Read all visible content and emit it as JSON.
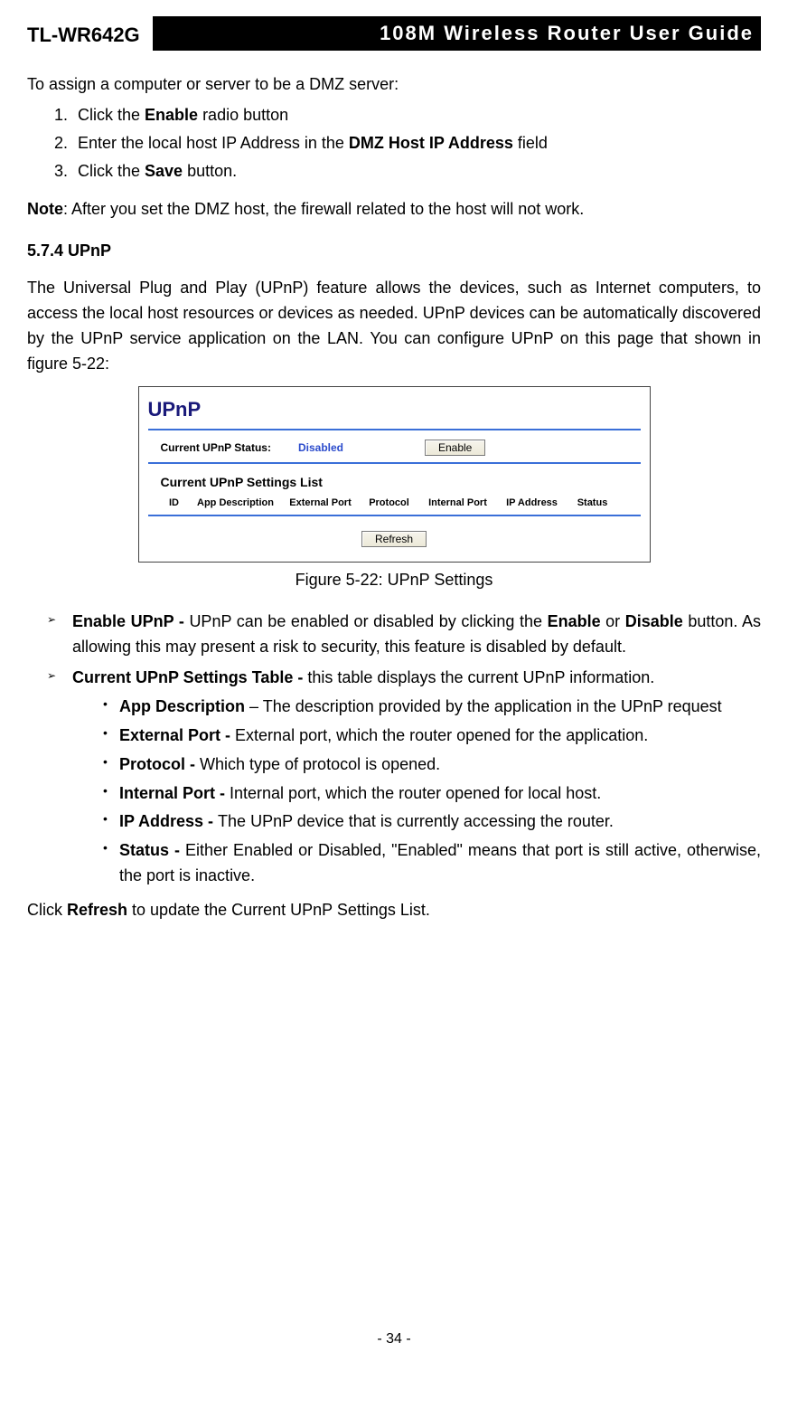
{
  "header": {
    "model": "TL-WR642G",
    "title": "108M Wireless Router User Guide"
  },
  "dmz": {
    "intro": "To assign a computer or server to be a DMZ server:",
    "steps": [
      {
        "pre": "Click the ",
        "bold": "Enable",
        "post": " radio button"
      },
      {
        "pre": "Enter the local host IP Address in the ",
        "bold": "DMZ Host IP Address",
        "post": " field"
      },
      {
        "pre": "Click the ",
        "bold": "Save",
        "post": " button."
      }
    ],
    "note_label": "Note",
    "note_text": ": After you set the DMZ host, the firewall related to the host will not work."
  },
  "section": {
    "number_title": "5.7.4 UPnP",
    "para": "The Universal Plug and Play (UPnP) feature allows the devices, such as Internet computers, to access the local host resources or devices as needed. UPnP devices can be automatically discovered by the UPnP service application on the LAN. You can configure UPnP on this page that shown in figure 5-22:"
  },
  "figure": {
    "title": "UPnP",
    "status_label": "Current UPnP Status:",
    "status_value": "Disabled",
    "enable_btn": "Enable",
    "list_heading": "Current UPnP Settings List",
    "cols": {
      "id": "ID",
      "app": "App Description",
      "ext": "External Port",
      "proto": "Protocol",
      "int": "Internal Port",
      "ip": "IP Address",
      "status": "Status"
    },
    "refresh_btn": "Refresh",
    "caption": "Figure 5-22: UPnP Settings"
  },
  "bullets": {
    "enable_b": "Enable UPnP - ",
    "enable_t1": "UPnP can be enabled or disabled by clicking the ",
    "enable_kw1": "Enable",
    "enable_t2": " or ",
    "enable_kw2": "Disable",
    "enable_t3": " button. As allowing this may present a risk to security, this feature is disabled by default.",
    "table_b": "Current UPnP Settings Table - ",
    "table_t": "this table displays the current UPnP information.",
    "sub": [
      {
        "b": "App Description",
        "t": " – The description provided by the application in the UPnP request"
      },
      {
        "b": "External Port - ",
        "t": "External port, which the router opened for the application."
      },
      {
        "b": "Protocol - ",
        "t": "Which type of protocol is opened."
      },
      {
        "b": "Internal Port - ",
        "t": "Internal port, which the router opened for local host."
      },
      {
        "b": "IP Address - ",
        "t": "The UPnP device that is currently accessing the router."
      },
      {
        "b": "Status - ",
        "t": "Either Enabled or Disabled, \"Enabled\" means that port is still active, otherwise, the port is inactive."
      }
    ]
  },
  "closing": {
    "pre": "Click ",
    "bold": "Refresh",
    "post": " to update the Current UPnP Settings List."
  },
  "page_number": "- 34 -"
}
